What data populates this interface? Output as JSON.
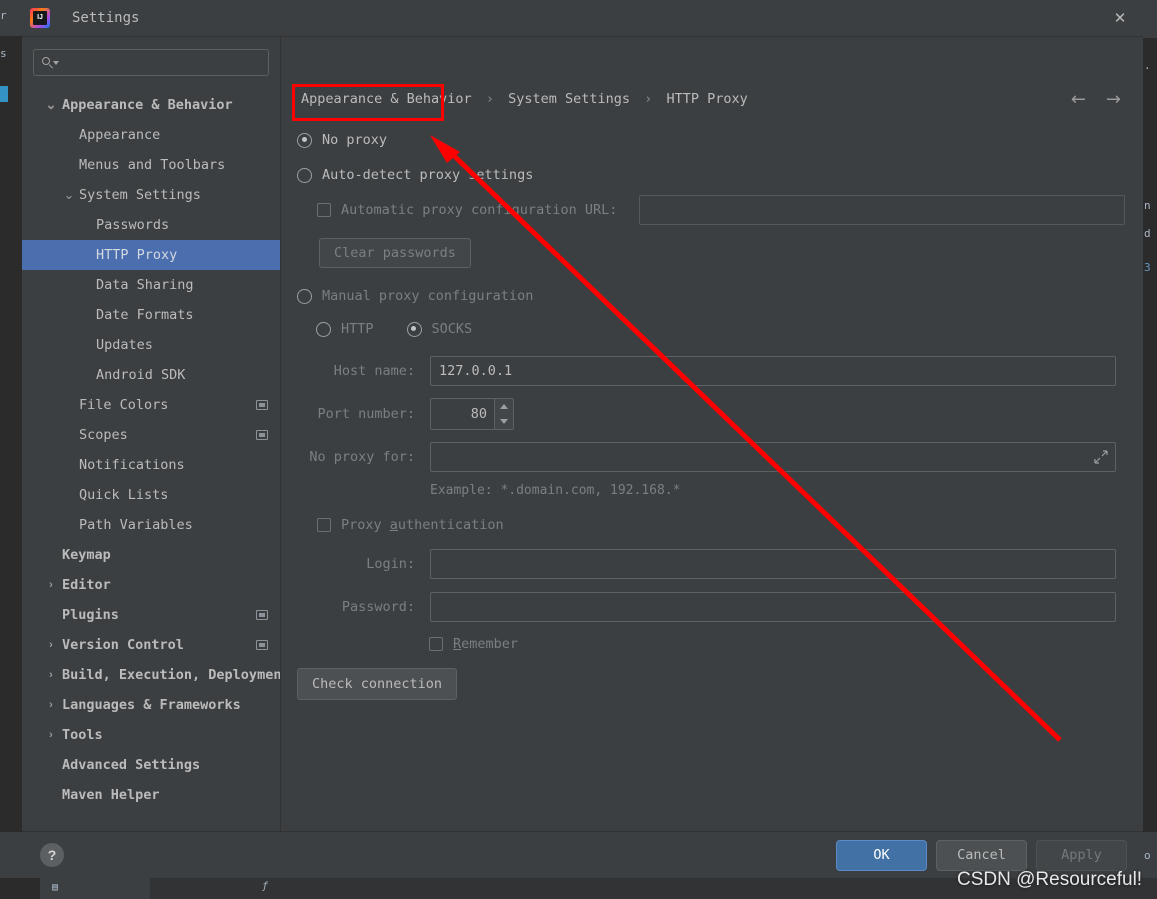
{
  "window": {
    "title": "Settings",
    "logo_icon": "intellij-idea-logo",
    "close_icon": "close-icon"
  },
  "search": {
    "value": "",
    "placeholder": "",
    "icon": "search-icon"
  },
  "sidebar": {
    "items": [
      {
        "label": "Appearance & Behavior",
        "level": 0,
        "arrow": "chevron-down-icon",
        "bold": true,
        "selected": false,
        "badge": false
      },
      {
        "label": "Appearance",
        "level": 1,
        "arrow": "",
        "bold": false,
        "selected": false,
        "badge": false
      },
      {
        "label": "Menus and Toolbars",
        "level": 1,
        "arrow": "",
        "bold": false,
        "selected": false,
        "badge": false
      },
      {
        "label": "System Settings",
        "level": 1,
        "arrow": "chevron-down-icon",
        "bold": false,
        "selected": false,
        "badge": false
      },
      {
        "label": "Passwords",
        "level": 2,
        "arrow": "",
        "bold": false,
        "selected": false,
        "badge": false
      },
      {
        "label": "HTTP Proxy",
        "level": 2,
        "arrow": "",
        "bold": false,
        "selected": true,
        "badge": false
      },
      {
        "label": "Data Sharing",
        "level": 2,
        "arrow": "",
        "bold": false,
        "selected": false,
        "badge": false
      },
      {
        "label": "Date Formats",
        "level": 2,
        "arrow": "",
        "bold": false,
        "selected": false,
        "badge": false
      },
      {
        "label": "Updates",
        "level": 2,
        "arrow": "",
        "bold": false,
        "selected": false,
        "badge": false
      },
      {
        "label": "Android SDK",
        "level": 2,
        "arrow": "",
        "bold": false,
        "selected": false,
        "badge": false
      },
      {
        "label": "File Colors",
        "level": 1,
        "arrow": "",
        "bold": false,
        "selected": false,
        "badge": true
      },
      {
        "label": "Scopes",
        "level": 1,
        "arrow": "",
        "bold": false,
        "selected": false,
        "badge": true
      },
      {
        "label": "Notifications",
        "level": 1,
        "arrow": "",
        "bold": false,
        "selected": false,
        "badge": false
      },
      {
        "label": "Quick Lists",
        "level": 1,
        "arrow": "",
        "bold": false,
        "selected": false,
        "badge": false
      },
      {
        "label": "Path Variables",
        "level": 1,
        "arrow": "",
        "bold": false,
        "selected": false,
        "badge": false
      },
      {
        "label": "Keymap",
        "level": 0,
        "arrow": "",
        "bold": true,
        "selected": false,
        "badge": false
      },
      {
        "label": "Editor",
        "level": 0,
        "arrow": "chevron-right-icon",
        "bold": true,
        "selected": false,
        "badge": false
      },
      {
        "label": "Plugins",
        "level": 0,
        "arrow": "",
        "bold": true,
        "selected": false,
        "badge": true
      },
      {
        "label": "Version Control",
        "level": 0,
        "arrow": "chevron-right-icon",
        "bold": true,
        "selected": false,
        "badge": true
      },
      {
        "label": "Build, Execution, Deployment",
        "level": 0,
        "arrow": "chevron-right-icon",
        "bold": true,
        "selected": false,
        "badge": false
      },
      {
        "label": "Languages & Frameworks",
        "level": 0,
        "arrow": "chevron-right-icon",
        "bold": true,
        "selected": false,
        "badge": false
      },
      {
        "label": "Tools",
        "level": 0,
        "arrow": "chevron-right-icon",
        "bold": true,
        "selected": false,
        "badge": false
      },
      {
        "label": "Advanced Settings",
        "level": 0,
        "arrow": "",
        "bold": true,
        "selected": false,
        "badge": false
      },
      {
        "label": "Maven Helper",
        "level": 0,
        "arrow": "",
        "bold": true,
        "selected": false,
        "badge": false
      }
    ]
  },
  "breadcrumb": {
    "parts": [
      "Appearance & Behavior",
      "System Settings",
      "HTTP Proxy"
    ],
    "separator": "›"
  },
  "nav": {
    "back_icon": "arrow-left-icon",
    "forward_icon": "arrow-right-icon"
  },
  "proxy": {
    "no_proxy_label": "No proxy",
    "no_proxy_checked": true,
    "auto_detect_label": "Auto-detect proxy settings",
    "auto_detect_checked": false,
    "auto_config_url_label": "Automatic proxy configuration URL:",
    "auto_config_url_checked": false,
    "auto_config_url_value": "",
    "clear_passwords_label": "Clear passwords",
    "manual_label": "Manual proxy configuration",
    "manual_checked": false,
    "http_label": "HTTP",
    "http_checked": false,
    "socks_label": "SOCKS",
    "socks_checked": true,
    "host_label": "Host name:",
    "host_value": "127.0.0.1",
    "port_label": "Port number:",
    "port_value": "80",
    "no_proxy_for_label": "No proxy for:",
    "no_proxy_for_value": "",
    "no_proxy_for_expand_icon": "expand-icon",
    "example_text": "Example: *.domain.com, 192.168.*",
    "auth_label_pre": "Proxy ",
    "auth_label_mnemonic": "a",
    "auth_label_post": "uthentication",
    "auth_checked": false,
    "login_label": "Login:",
    "login_value": "",
    "password_label": "Password:",
    "password_value": "",
    "remember_label_mnemonic": "R",
    "remember_label_post": "emember",
    "remember_checked": false,
    "check_connection_label": "Check connection"
  },
  "footer": {
    "help_label": "?",
    "ok_label": "OK",
    "cancel_label": "Cancel",
    "apply_label": "Apply",
    "apply_disabled": true
  },
  "annotations": {
    "highlight_color": "#ff0000",
    "watermark": "CSDN @Resourceful!"
  },
  "background": {
    "left_lines": [
      "r",
      "s"
    ],
    "right_lines": [
      ". c",
      "n",
      "d",
      "3"
    ],
    "bottom_right": "o"
  }
}
